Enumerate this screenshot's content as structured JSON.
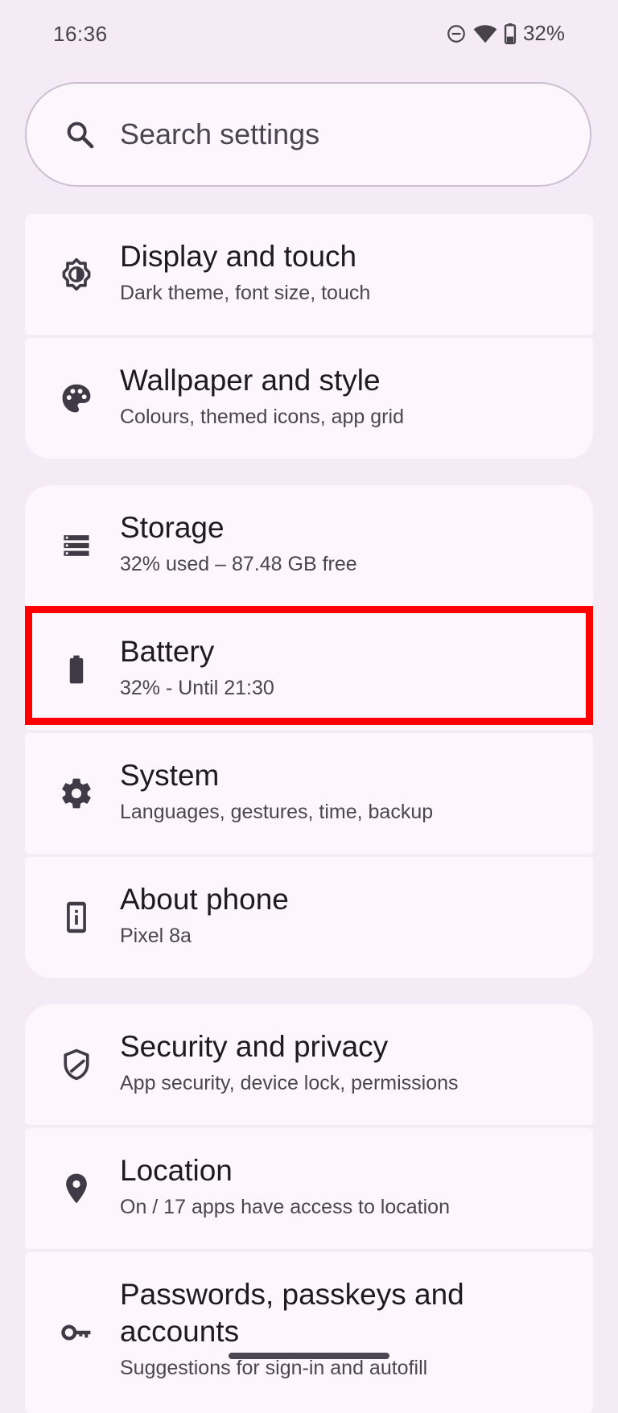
{
  "status_bar": {
    "time": "16:36",
    "battery_percent": "32%",
    "icons": [
      "do-not-disturb-icon",
      "wifi-icon",
      "battery-icon"
    ]
  },
  "search": {
    "placeholder": "Search settings"
  },
  "groups": [
    {
      "items": [
        {
          "title": "Display and touch",
          "subtitle": "Dark theme, font size, touch",
          "icon": "display-brightness-icon"
        },
        {
          "title": "Wallpaper and style",
          "subtitle": "Colours, themed icons, app grid",
          "icon": "palette-icon"
        }
      ]
    },
    {
      "items": [
        {
          "title": "Storage",
          "subtitle": "32% used – 87.48 GB free",
          "icon": "storage-icon"
        },
        {
          "title": "Battery",
          "subtitle": "32% - Until 21:30",
          "icon": "battery-icon"
        },
        {
          "title": "System",
          "subtitle": "Languages, gestures, time, backup",
          "icon": "gear-icon"
        },
        {
          "title": "About phone",
          "subtitle": "Pixel 8a",
          "icon": "phone-info-icon"
        }
      ]
    },
    {
      "items": [
        {
          "title": "Security and privacy",
          "subtitle": "App security, device lock, permissions",
          "icon": "shield-icon"
        },
        {
          "title": "Location",
          "subtitle": "On / 17 apps have access to location",
          "icon": "location-pin-icon"
        },
        {
          "title": "Passwords, passkeys and accounts",
          "subtitle": "Suggestions for sign-in and autofill",
          "icon": "key-icon"
        }
      ]
    }
  ],
  "colors": {
    "background": "#f5ebf7",
    "surface": "#fdf7fd",
    "highlight": "#ff0000"
  }
}
